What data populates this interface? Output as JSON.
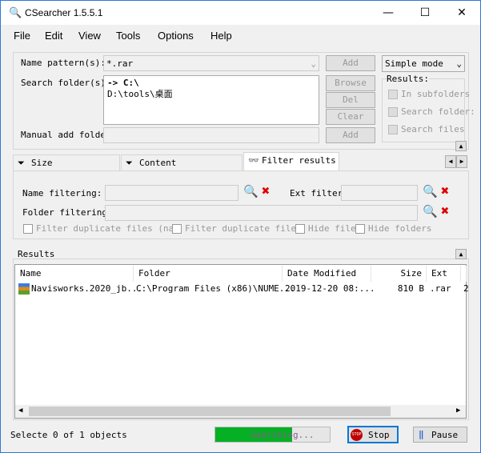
{
  "window": {
    "title": "CSearcher 1.5.5.1",
    "minimize": "—",
    "maximize": "☐",
    "close": "✕"
  },
  "menu": [
    "File",
    "Edit",
    "View",
    "Tools",
    "Options",
    "Help"
  ],
  "search": {
    "name_label": "Name pattern(s):",
    "name_value": "*.rar",
    "add_label": "Add",
    "folder_label": "Search folder(s):",
    "folders": [
      "-> C:\\",
      "D:\\tools\\桌面"
    ],
    "browse": "Browse",
    "del": "Del",
    "clear": "Clear",
    "manual_label": "Manual add folder",
    "manual_add": "Add",
    "mode": "Simple mode",
    "results_group": "Results:",
    "opts": [
      "In subfolders",
      "Search folder:",
      "Search files"
    ]
  },
  "tabs": [
    {
      "label": "Size restrictions"
    },
    {
      "label": "Content restrictions"
    },
    {
      "label": "Filter results",
      "active": true
    }
  ],
  "filter": {
    "name_label": "Name filtering:",
    "ext_label": "Ext filtering:",
    "folder_label": "Folder filtering:",
    "checks": [
      "Filter duplicate files (name",
      "Filter duplicate files",
      "Hide files",
      "Hide folders"
    ]
  },
  "results": {
    "label": "Results",
    "columns": [
      "Name",
      "Folder",
      "Date Modified",
      "Size",
      "Ext",
      "I"
    ],
    "rows": [
      [
        "Navisworks.2020_jb...",
        "C:\\Program Files (x86)\\NUME...",
        "2019-12-20 08:...",
        "810 B",
        ".rar",
        "2"
      ]
    ]
  },
  "status": {
    "text": "Selecte 0 of 1 objects",
    "progress_text": "Searching...",
    "progress_percent": 67,
    "stop": "Stop",
    "pause": "Pause",
    "stop_icon_text": "STOP"
  },
  "colors": {
    "progress": "#06b025",
    "accent": "#0078d7",
    "stop": "#c00000"
  }
}
